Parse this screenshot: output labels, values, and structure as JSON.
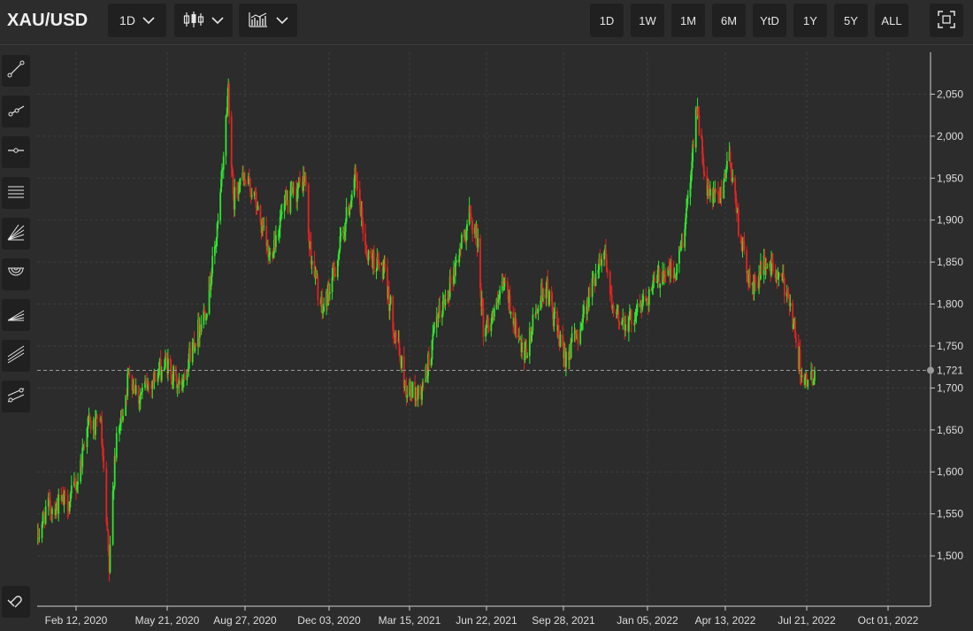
{
  "header": {
    "symbol": "XAU/USD",
    "interval_label": "1D",
    "ranges": [
      "1D",
      "1W",
      "1M",
      "6M",
      "YtD",
      "1Y",
      "5Y",
      "ALL"
    ]
  },
  "sidebar": {
    "tools": [
      "trend-line-icon",
      "ray-line-icon",
      "horizontal-line-icon",
      "parallel-channel-icon",
      "fan-icon",
      "fibonacci-arc-icon",
      "fibonacci-retracement-icon",
      "pitchfork-icon",
      "regression-channel-icon",
      "magnet-icon"
    ]
  },
  "colors": {
    "up": "#2ee62e",
    "down": "#e62222",
    "background": "#2b2c2b",
    "grid": "#3d3e3d",
    "text": "#dddddd"
  },
  "chart_data": {
    "type": "candlestick",
    "current_price": "1,721",
    "current_price_value": 1721,
    "y_ticks": [
      1500,
      1550,
      1600,
      1650,
      1700,
      1750,
      1800,
      1850,
      1900,
      1950,
      2000,
      2050
    ],
    "y_tick_labels": [
      "1,500",
      "1,550",
      "1,600",
      "1,650",
      "1,700",
      "1,750",
      "1,800",
      "1,850",
      "1,900",
      "1,950",
      "2,000",
      "2,050"
    ],
    "ylim": [
      1440,
      2100
    ],
    "x_tick_labels": [
      "Feb 12, 2020",
      "May 21, 2020",
      "Aug 27, 2020",
      "Dec 03, 2020",
      "Mar 15, 2021",
      "Jun 22, 2021",
      "Sep 28, 2021",
      "Jan 05, 2022",
      "Apr 13, 2022",
      "Jul 21, 2022",
      "Oct 01, 2022"
    ],
    "price_path": [
      [
        "2020-01-01",
        1520
      ],
      [
        "2020-01-10",
        1555
      ],
      [
        "2020-01-20",
        1560
      ],
      [
        "2020-02-05",
        1565
      ],
      [
        "2020-02-15",
        1595
      ],
      [
        "2020-02-24",
        1660
      ],
      [
        "2020-03-04",
        1650
      ],
      [
        "2020-03-09",
        1670
      ],
      [
        "2020-03-19",
        1480
      ],
      [
        "2020-03-25",
        1620
      ],
      [
        "2020-04-10",
        1720
      ],
      [
        "2020-04-20",
        1690
      ],
      [
        "2020-05-05",
        1710
      ],
      [
        "2020-05-20",
        1730
      ],
      [
        "2020-06-05",
        1700
      ],
      [
        "2020-06-20",
        1745
      ],
      [
        "2020-07-10",
        1800
      ],
      [
        "2020-07-25",
        1900
      ],
      [
        "2020-08-06",
        2060
      ],
      [
        "2020-08-12",
        1920
      ],
      [
        "2020-08-20",
        1950
      ],
      [
        "2020-09-05",
        1935
      ],
      [
        "2020-09-24",
        1855
      ],
      [
        "2020-10-10",
        1910
      ],
      [
        "2020-11-05",
        1950
      ],
      [
        "2020-11-10",
        1870
      ],
      [
        "2020-11-25",
        1790
      ],
      [
        "2020-12-10",
        1840
      ],
      [
        "2021-01-05",
        1950
      ],
      [
        "2021-01-20",
        1860
      ],
      [
        "2021-02-10",
        1840
      ],
      [
        "2021-02-28",
        1750
      ],
      [
        "2021-03-10",
        1700
      ],
      [
        "2021-03-30",
        1690
      ],
      [
        "2021-04-20",
        1780
      ],
      [
        "2021-05-10",
        1835
      ],
      [
        "2021-05-31",
        1905
      ],
      [
        "2021-06-10",
        1880
      ],
      [
        "2021-06-18",
        1770
      ],
      [
        "2021-07-05",
        1795
      ],
      [
        "2021-07-15",
        1825
      ],
      [
        "2021-08-09",
        1730
      ],
      [
        "2021-08-25",
        1795
      ],
      [
        "2021-09-05",
        1825
      ],
      [
        "2021-09-28",
        1735
      ],
      [
        "2021-10-15",
        1765
      ],
      [
        "2021-11-10",
        1855
      ],
      [
        "2021-11-16",
        1865
      ],
      [
        "2021-11-25",
        1785
      ],
      [
        "2021-12-15",
        1780
      ],
      [
        "2022-01-05",
        1810
      ],
      [
        "2022-01-25",
        1840
      ],
      [
        "2022-02-10",
        1835
      ],
      [
        "2022-02-24",
        1915
      ],
      [
        "2022-03-08",
        2040
      ],
      [
        "2022-03-20",
        1930
      ],
      [
        "2022-04-05",
        1925
      ],
      [
        "2022-04-18",
        1980
      ],
      [
        "2022-05-01",
        1880
      ],
      [
        "2022-05-15",
        1815
      ],
      [
        "2022-06-01",
        1850
      ],
      [
        "2022-06-15",
        1835
      ],
      [
        "2022-06-30",
        1810
      ],
      [
        "2022-07-10",
        1740
      ],
      [
        "2022-07-21",
        1700
      ],
      [
        "2022-07-28",
        1721
      ]
    ]
  }
}
